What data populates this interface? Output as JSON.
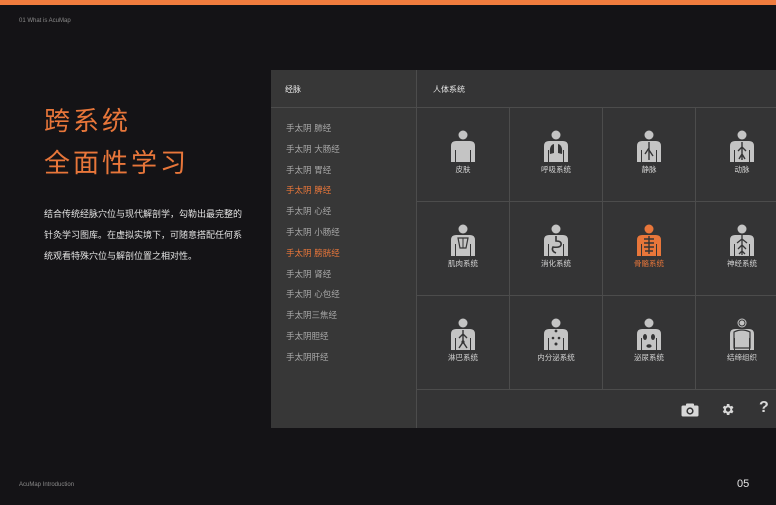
{
  "header": {
    "section_label": "01 What is AcuMap"
  },
  "hero": {
    "line1": "跨系统",
    "line2": "全面性学习",
    "description": "结合传统经脉穴位与现代解剖学，勾勒出最完整的针灸学习图库。在虚拟实境下，可随意搭配任何系统观看特殊穴位与解剖位置之相对性。"
  },
  "colors": {
    "accent": "#e8763a",
    "icon": "#c4c4c4"
  },
  "panel": {
    "meridian_header": "经脉",
    "system_header": "人体系统",
    "meridians": [
      {
        "label": "手太阴 肺经",
        "active": false
      },
      {
        "label": "手太阴 大肠经",
        "active": false
      },
      {
        "label": "手太阴 胃经",
        "active": false
      },
      {
        "label": "手太阴 脾经",
        "active": true
      },
      {
        "label": "手太阴 心经",
        "active": false
      },
      {
        "label": "手太阴 小肠经",
        "active": false
      },
      {
        "label": "手太阴 膀胱经",
        "active": true
      },
      {
        "label": "手太阴 肾经",
        "active": false
      },
      {
        "label": "手太阴 心包经",
        "active": false
      },
      {
        "label": "手太阴三焦经",
        "active": false
      },
      {
        "label": "手太阴胆经",
        "active": false
      },
      {
        "label": "手太阴肝经",
        "active": false
      }
    ],
    "systems": [
      {
        "label": "皮肤",
        "icon": "skin-icon",
        "active": false
      },
      {
        "label": "呼吸系统",
        "icon": "lungs-icon",
        "active": false
      },
      {
        "label": "静脉",
        "icon": "vein-icon",
        "active": false
      },
      {
        "label": "动脉",
        "icon": "artery-icon",
        "active": false
      },
      {
        "label": "肌肉系统",
        "icon": "muscle-icon",
        "active": false
      },
      {
        "label": "消化系统",
        "icon": "digestive-icon",
        "active": false
      },
      {
        "label": "骨骼系统",
        "icon": "skeleton-icon",
        "active": true
      },
      {
        "label": "神经系统",
        "icon": "nerve-icon",
        "active": false
      },
      {
        "label": "淋巴系统",
        "icon": "lymph-icon",
        "active": false
      },
      {
        "label": "内分泌系统",
        "icon": "endocrine-icon",
        "active": false
      },
      {
        "label": "泌尿系统",
        "icon": "urinary-icon",
        "active": false
      },
      {
        "label": "结缔组织",
        "icon": "connective-tissue-icon",
        "active": false
      }
    ],
    "toolbar": {
      "help_label": "?"
    }
  },
  "footer": {
    "label": "AcuMap Introduction",
    "page_number": "05"
  }
}
